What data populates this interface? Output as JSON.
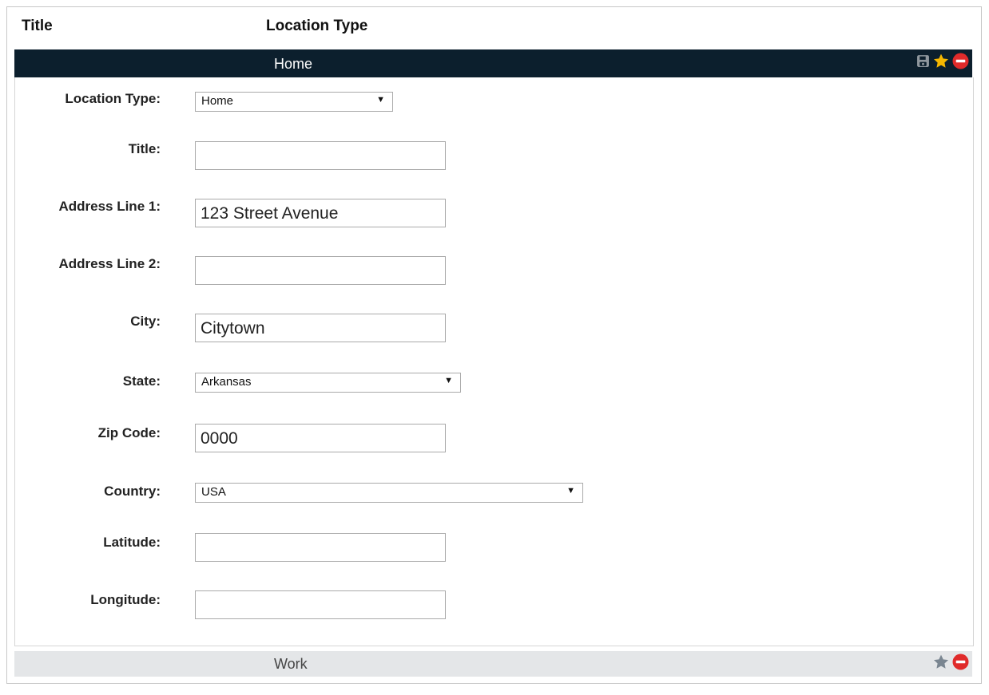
{
  "header": {
    "title_col": "Title",
    "type_col": "Location Type"
  },
  "rows": [
    {
      "label": "Home",
      "active": true,
      "icons": [
        "save-icon",
        "star-icon",
        "remove-icon"
      ]
    },
    {
      "label": "Work",
      "active": false,
      "icons": [
        "star-icon",
        "remove-icon"
      ]
    }
  ],
  "form": {
    "location_type": {
      "label": "Location Type:",
      "value": "Home"
    },
    "title": {
      "label": "Title:",
      "value": ""
    },
    "address1": {
      "label": "Address Line 1:",
      "value": "123 Street Avenue"
    },
    "address2": {
      "label": "Address Line 2:",
      "value": ""
    },
    "city": {
      "label": "City:",
      "value": "Citytown"
    },
    "state": {
      "label": "State:",
      "value": "Arkansas"
    },
    "zip": {
      "label": "Zip Code:",
      "value": "0000"
    },
    "country": {
      "label": "Country:",
      "value": "USA"
    },
    "latitude": {
      "label": "Latitude:",
      "value": ""
    },
    "longitude": {
      "label": "Longitude:",
      "value": ""
    }
  },
  "colors": {
    "active_row_bg": "#0c1f2d",
    "inactive_row_bg": "#e4e6e8",
    "star_active": "#f5b700",
    "star_inactive": "#7a8691",
    "remove": "#e02b2b"
  }
}
